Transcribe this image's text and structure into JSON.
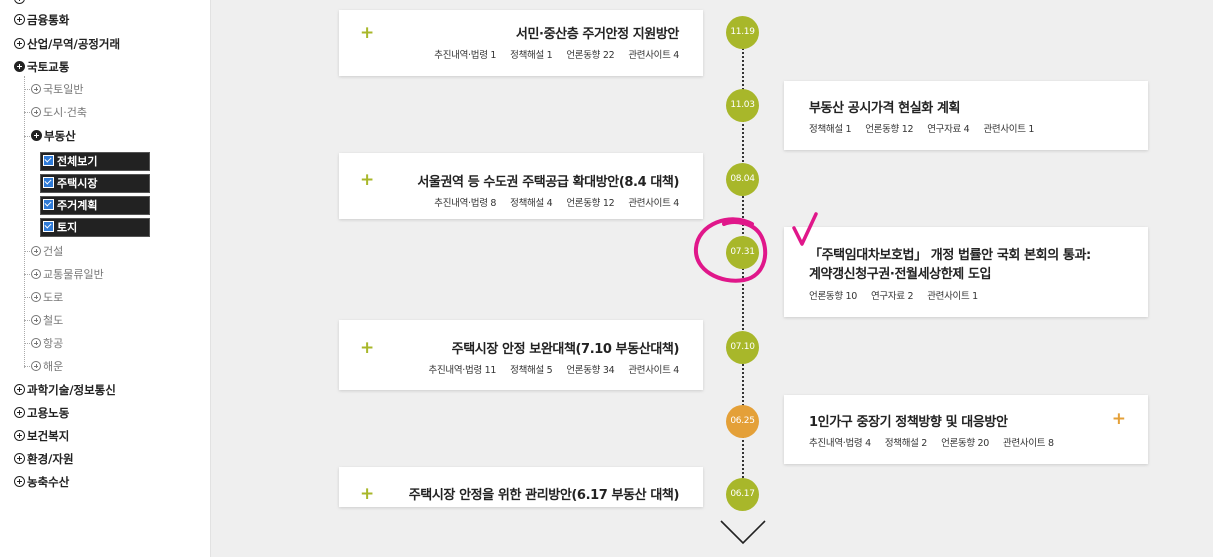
{
  "sidebar": {
    "top_partial": "",
    "items": [
      {
        "label": "금융통화"
      },
      {
        "label": "산업/무역/공정거래"
      },
      {
        "label": "국토교통"
      },
      {
        "label": "국토일반"
      },
      {
        "label": "도시·건축"
      },
      {
        "label": "부동산"
      },
      {
        "label": "전체보기"
      },
      {
        "label": "주택시장"
      },
      {
        "label": "주거계획"
      },
      {
        "label": "토지"
      },
      {
        "label": "건설"
      },
      {
        "label": "교통물류일반"
      },
      {
        "label": "도로"
      },
      {
        "label": "철도"
      },
      {
        "label": "항공"
      },
      {
        "label": "해운"
      },
      {
        "label": "과학기술/정보통신"
      },
      {
        "label": "고용노동"
      },
      {
        "label": "보건복지"
      },
      {
        "label": "환경/자원"
      },
      {
        "label": "농축수산"
      }
    ]
  },
  "timeline": {
    "entries": [
      {
        "date": "11.19",
        "title": "서민·중산층 주거안정 지원방안",
        "meta": [
          "추진내역·법령 1",
          "정책해설 1",
          "언론동향 22",
          "관련사이트 4"
        ]
      },
      {
        "date": "11.03",
        "title": "부동산 공시가격 현실화 계획",
        "meta": [
          "정책해설 1",
          "언론동향 12",
          "연구자료 4",
          "관련사이트 1"
        ]
      },
      {
        "date": "08.04",
        "title": "서울권역 등 수도권 주택공급 확대방안(8.4 대책)",
        "meta": [
          "추진내역·법령 8",
          "정책해설 4",
          "언론동향 12",
          "관련사이트 4"
        ]
      },
      {
        "date": "07.31",
        "title_line1": "「주택임대차보호법」 개정 법률안 국회 본회의 통과:",
        "title_line2": "계약갱신청구권·전월세상한제 도입",
        "meta": [
          "언론동향 10",
          "연구자료 2",
          "관련사이트 1"
        ]
      },
      {
        "date": "07.10",
        "title": "주택시장 안정 보완대책(7.10 부동산대책)",
        "meta": [
          "추진내역·법령 11",
          "정책해설 5",
          "언론동향 34",
          "관련사이트 4"
        ]
      },
      {
        "date": "06.25",
        "title": "1인가구 중장기 정책방향 및 대응방안",
        "meta": [
          "추진내역·법령 4",
          "정책해설 2",
          "언론동향 20",
          "관련사이트 8"
        ]
      },
      {
        "date": "06.17",
        "title": "주택시장 안정을 위한 관리방안(6.17 부동산 대책)",
        "meta": []
      }
    ],
    "expand_symbol": "+"
  },
  "colors": {
    "accent_green": "#a8b72a",
    "accent_orange": "#e4a038",
    "annotation_pink": "#e0178a"
  }
}
